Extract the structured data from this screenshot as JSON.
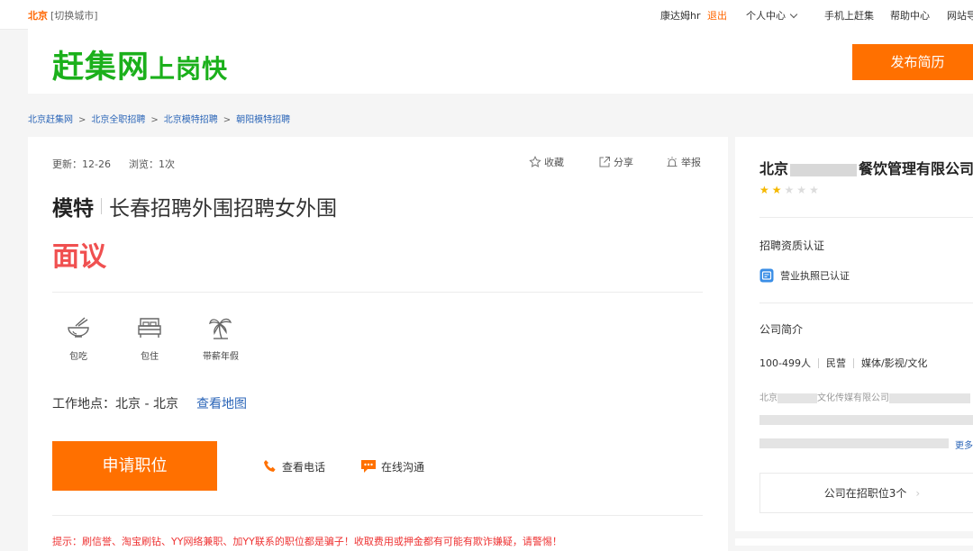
{
  "topbar": {
    "city": "北京",
    "switch_city": "[切换城市]",
    "username": "康达姆hr",
    "logout": "退出",
    "personal_center": "个人中心",
    "mobile": "手机上赶集",
    "help": "帮助中心",
    "site_nav": "网站导"
  },
  "header": {
    "logo_main": "赶集网",
    "logo_sub": "上岗快",
    "publish_resume": "发布简历"
  },
  "breadcrumb": [
    "北京赶集网",
    "北京全职招聘",
    "北京模特招聘",
    "朝阳模特招聘"
  ],
  "job": {
    "updated": "更新：12-26",
    "views": "浏览：1次",
    "collect": "收藏",
    "share": "分享",
    "report": "举报",
    "category": "模特",
    "title": "长春招聘外围招聘女外围",
    "salary": "面议",
    "benefits": [
      {
        "label": "包吃",
        "icon": "bowl-icon"
      },
      {
        "label": "包住",
        "icon": "bed-icon"
      },
      {
        "label": "带薪年假",
        "icon": "palm-tree-icon"
      }
    ],
    "location_label": "工作地点：北京 - 北京",
    "view_map": "查看地图",
    "apply": "申请职位",
    "view_phone": "查看电话",
    "online_chat": "在线沟通",
    "tip": "提示：刷信誉、淘宝刷钻、YY网络兼职、加YY联系的职位都是骗子！收取费用或押金都有可能有欺诈嫌疑，请警惕！"
  },
  "company": {
    "name_prefix": "北京",
    "name_suffix": "餐饮管理有限公司",
    "rating": 2,
    "rating_max": 5,
    "cert_title": "招聘资质认证",
    "license": "营业执照已认证",
    "intro_title": "公司简介",
    "size": "100-499人",
    "type": "民营",
    "industry": "媒体/影视/文化",
    "desc_prefix": "北京",
    "desc_mid": "文化传媒有限公司",
    "more": "更多",
    "jobs_button": "公司在招职位3个",
    "jobs_arrow": "›"
  },
  "colors": {
    "accent": "#ff7000",
    "logo_green": "#1bb01b",
    "salary_red": "#f05050",
    "link_blue": "#2c66b8"
  }
}
